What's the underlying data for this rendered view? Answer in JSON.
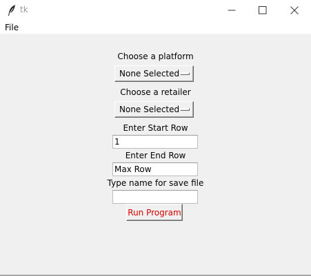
{
  "window": {
    "title": "tk",
    "controls": {
      "minimize": "minimize-icon",
      "maximize": "maximize-icon",
      "close": "close-icon"
    },
    "app_icon": "feather-icon"
  },
  "menubar": {
    "file_label": "File"
  },
  "form": {
    "platform_label": "Choose a platform",
    "platform_value": "None Selected",
    "retailer_label": "Choose a retailer",
    "retailer_value": "None Selected",
    "start_row_label": "Enter Start Row",
    "start_row_value": "1",
    "end_row_label": "Enter End Row",
    "end_row_value": "Max Row",
    "save_file_label": "Type name for save file",
    "save_file_value": "",
    "run_button_label": "Run Program"
  },
  "colors": {
    "client_bg": "#f0f0f0",
    "run_button_text": "#d40000",
    "title_text": "#999999"
  }
}
